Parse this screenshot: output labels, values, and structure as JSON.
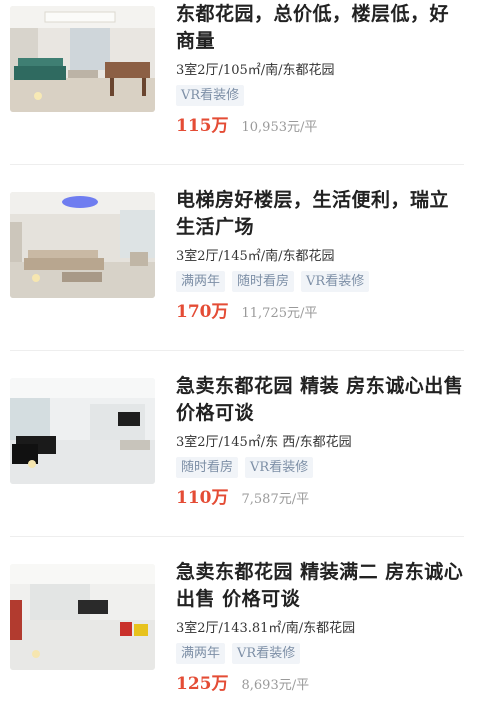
{
  "listings": [
    {
      "title": "东都花园，总价低，楼层低，好商量",
      "info": "3室2厅/105㎡/南/东都花园",
      "tags": [
        "VR看装修"
      ],
      "total_price": "115万",
      "unit_price": "10,953元/平"
    },
    {
      "title": "电梯房好楼层，生活便利，瑞立生活广场",
      "info": "3室2厅/145㎡/南/东都花园",
      "tags": [
        "满两年",
        "随时看房",
        "VR看装修"
      ],
      "total_price": "170万",
      "unit_price": "11,725元/平"
    },
    {
      "title": "急卖东都花园 精装 房东诚心出售 价格可谈",
      "info": "3室2厅/145㎡/东 西/东都花园",
      "tags": [
        "随时看房",
        "VR看装修"
      ],
      "total_price": "110万",
      "unit_price": "7,587元/平"
    },
    {
      "title": "急卖东都花园 精装满二 房东诚心出售 价格可谈",
      "info": "3室2厅/143.81㎡/南/东都花园",
      "tags": [
        "满两年",
        "VR看装修"
      ],
      "total_price": "125万",
      "unit_price": "8,693元/平"
    }
  ],
  "colors": {
    "price_red": "#e44c35",
    "tag_bg": "#f1f4f8",
    "tag_text": "#7d8fa6"
  }
}
